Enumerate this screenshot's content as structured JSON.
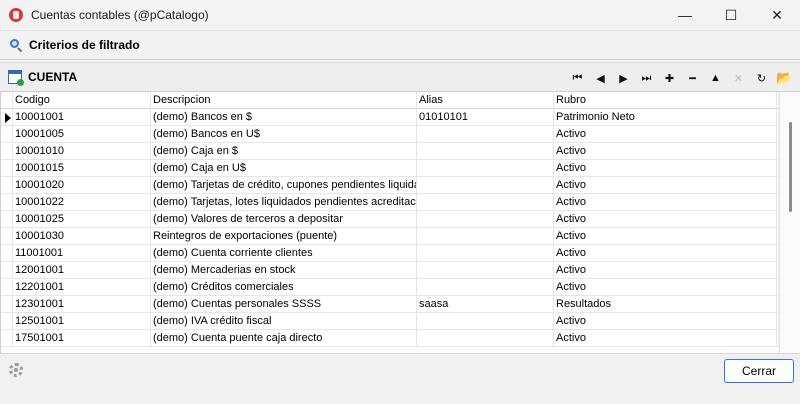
{
  "window": {
    "title": "Cuentas contables (@pCatalogo)",
    "controls": {
      "minimize": "—",
      "maximize": "☐",
      "close": "✕"
    }
  },
  "filter": {
    "label": "Criterios de filtrado"
  },
  "grid": {
    "title": "CUENTA",
    "nav": [
      {
        "name": "first-record-button",
        "glyph": "⏮",
        "enabled": true
      },
      {
        "name": "prior-record-button",
        "glyph": "◀",
        "enabled": true
      },
      {
        "name": "next-record-button",
        "glyph": "▶",
        "enabled": true
      },
      {
        "name": "last-record-button",
        "glyph": "⏭",
        "enabled": true
      },
      {
        "name": "insert-record-button",
        "glyph": "✚",
        "enabled": true
      },
      {
        "name": "delete-record-button",
        "glyph": "━",
        "enabled": true
      },
      {
        "name": "edit-record-button",
        "glyph": "▲",
        "enabled": true
      },
      {
        "name": "cancel-edit-button",
        "glyph": "✕",
        "enabled": false
      },
      {
        "name": "refresh-button",
        "glyph": "↻",
        "enabled": true
      },
      {
        "name": "folder-button",
        "glyph": "📂",
        "enabled": true
      }
    ],
    "columns": [
      "Codigo",
      "Descripcion",
      "Alias",
      "Rubro"
    ],
    "rows": [
      [
        "10001001",
        "(demo) Bancos en $",
        "01010101",
        "Patrimonio Neto"
      ],
      [
        "10001005",
        "(demo) Bancos en U$",
        "",
        "Activo"
      ],
      [
        "10001010",
        "(demo) Caja en $",
        "",
        "Activo"
      ],
      [
        "10001015",
        "(demo) Caja en U$",
        "",
        "Activo"
      ],
      [
        "10001020",
        "(demo) Tarjetas de crédito, cupones pendientes liquidación",
        "",
        "Activo"
      ],
      [
        "10001022",
        "(demo) Tarjetas, lotes liquidados pendientes acreditación",
        "",
        "Activo"
      ],
      [
        "10001025",
        "(demo) Valores de terceros a depositar",
        "",
        "Activo"
      ],
      [
        "10001030",
        "Reintegros de exportaciones (puente)",
        "",
        "Activo"
      ],
      [
        "11001001",
        "(demo) Cuenta corriente clientes",
        "",
        "Activo"
      ],
      [
        "12001001",
        "(demo) Mercaderias en stock",
        "",
        "Activo"
      ],
      [
        "12201001",
        "(demo) Créditos comerciales",
        "",
        "Activo"
      ],
      [
        "12301001",
        "(demo) Cuentas personales SSSS",
        "saasa",
        "Resultados"
      ],
      [
        "12501001",
        "(demo) IVA crédito fiscal",
        "",
        "Activo"
      ],
      [
        "17501001",
        "(demo) Cuenta puente caja directo",
        "",
        "Activo"
      ]
    ],
    "current_row": 0
  },
  "footer": {
    "close_label": "Cerrar"
  }
}
